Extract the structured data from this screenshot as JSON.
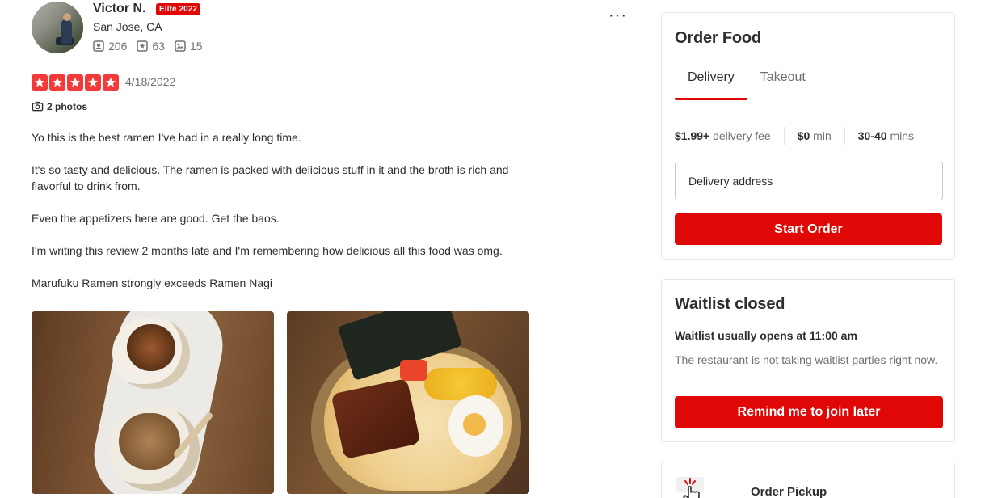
{
  "review": {
    "user_name": "Victor N.",
    "elite_badge": "Elite 2022",
    "location": "San Jose, CA",
    "stats": {
      "friends": "206",
      "reviews": "63",
      "photos": "15"
    },
    "rating": 5,
    "date": "4/18/2022",
    "photos_label": "2 photos",
    "paragraphs": [
      "Yo this is the best ramen I've had in a really long time.",
      "It's so tasty and delicious. The ramen is packed with delicious stuff in it and the broth is rich and flavorful to drink from.",
      "Even the appetizers here are good. Get the baos.",
      "I'm writing this review 2 months late and I'm remembering how delicious all this food was omg.",
      "Marufuku Ramen strongly exceeds Ramen Nagi"
    ],
    "more_label": "···"
  },
  "order_food": {
    "title": "Order Food",
    "tabs": [
      {
        "label": "Delivery"
      },
      {
        "label": "Takeout"
      }
    ],
    "fees": [
      {
        "value": "$1.99+",
        "label": "delivery fee"
      },
      {
        "value": "$0",
        "label": "min"
      },
      {
        "value": "30-40",
        "label": "mins"
      }
    ],
    "address_placeholder": "Delivery address",
    "start_button": "Start Order"
  },
  "waitlist": {
    "title": "Waitlist closed",
    "subtitle": "Waitlist usually opens at 11:00 am",
    "note": "The restaurant is not taking waitlist parties right now.",
    "button": "Remind me to join later"
  },
  "pickup": {
    "label": "Order Pickup"
  },
  "colors": {
    "accent": "#e00707",
    "star": "#f43939",
    "text": "#2d2e2f",
    "muted": "#6e7072"
  }
}
